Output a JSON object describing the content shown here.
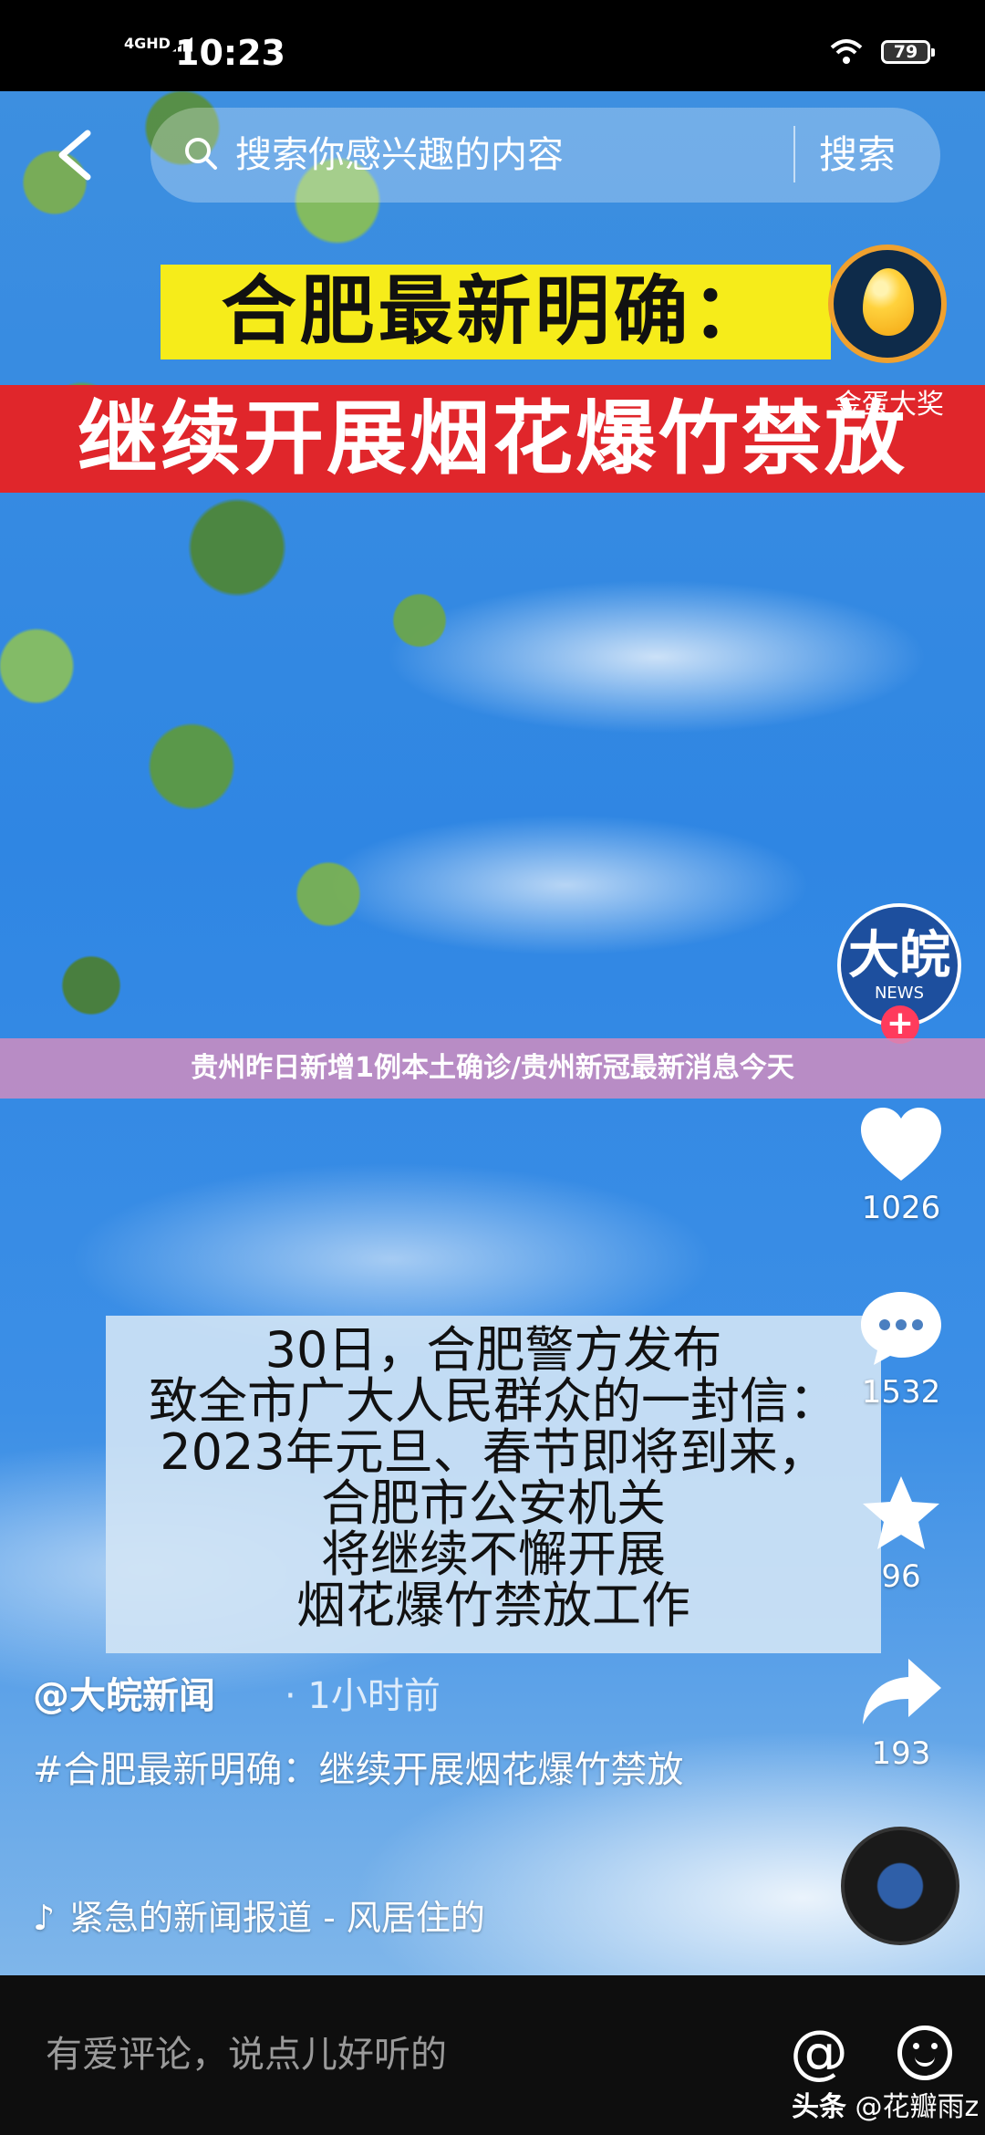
{
  "status_bar": {
    "network": "4GHD",
    "time": "10:23",
    "battery": "79"
  },
  "search": {
    "placeholder": "搜索你感兴趣的内容",
    "button": "搜索"
  },
  "video": {
    "headline_top": "合肥最新明确：",
    "headline_bottom": "继续开展烟花爆竹禁放",
    "overlay_caption": "贵州昨日新增1例本土确诊/贵州新冠最新消息今天",
    "notice_lines": [
      "30日，合肥警方发布",
      "致全市广大人民群众的一封信：",
      "2023年元旦、春节即将到来，",
      "合肥市公安机关",
      "将继续不懈开展",
      "烟花爆竹禁放工作"
    ]
  },
  "reward_widget": {
    "label": "金蛋大奖"
  },
  "creator": {
    "avatar_text": "大皖",
    "avatar_sub": "NEWS",
    "handle": "@大皖新闻",
    "time_ago": "· 1小时前",
    "caption": "#合肥最新明确：继续开展烟花爆竹禁放",
    "music": "紧急的新闻报道 - 风居住的"
  },
  "actions": {
    "likes": "1026",
    "comments": "1532",
    "favorites": "96",
    "shares": "193"
  },
  "comment_bar": {
    "placeholder": "有爱评论，说点儿好听的"
  },
  "watermark": {
    "brand": "头条",
    "user": "@花瓣雨z"
  }
}
